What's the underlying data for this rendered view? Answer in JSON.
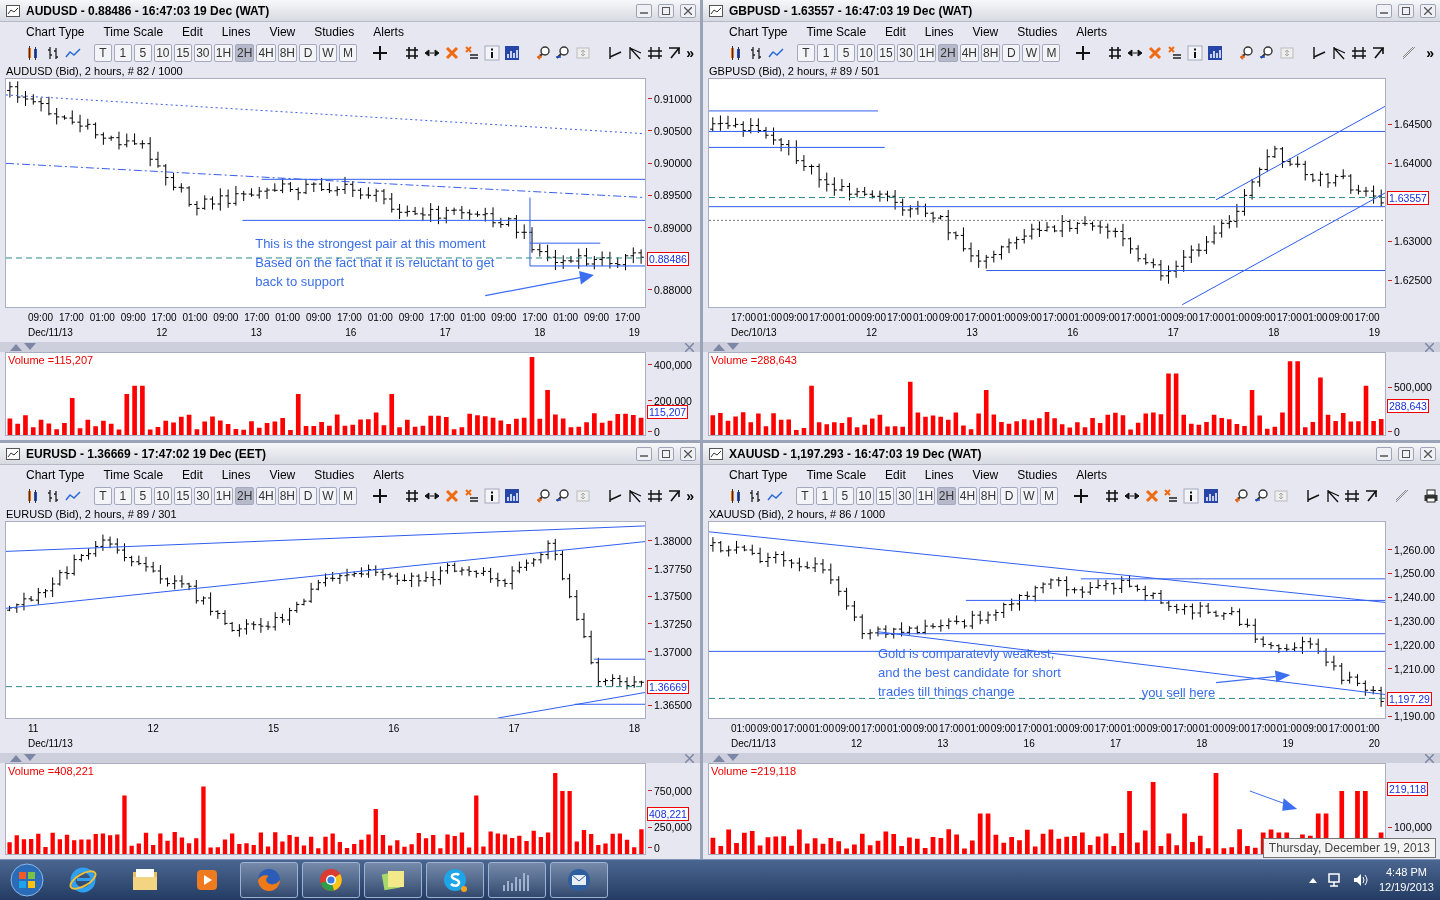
{
  "panes": [
    {
      "title": "AUDUSD - 0.88486 - 16:47:03  19 Dec (WAT)",
      "menu": [
        "Chart Type",
        "Time Scale",
        "Edit",
        "Lines",
        "View",
        "Studies",
        "Alerts"
      ],
      "timeframes": [
        {
          "label": "T",
          "selected": false
        },
        {
          "label": "1",
          "selected": false
        },
        {
          "label": "5",
          "selected": false
        },
        {
          "label": "10",
          "selected": false
        },
        {
          "label": "15",
          "selected": false
        },
        {
          "label": "30",
          "selected": false
        },
        {
          "label": "1H",
          "selected": false
        },
        {
          "label": "2H",
          "selected": true
        },
        {
          "label": "4H",
          "selected": false
        },
        {
          "label": "8H",
          "selected": false
        },
        {
          "label": "D",
          "selected": false
        },
        {
          "label": "W",
          "selected": false
        },
        {
          "label": "M",
          "selected": false
        }
      ],
      "overflow": "»",
      "info": "AUDUSD (Bid), 2 hours, # 82 / 1000",
      "price_axis": [
        "0.91000",
        "0.90500",
        "0.90000",
        "0.89500",
        "0.89000",
        "0.88000"
      ],
      "last_price": "0.88486",
      "times": [
        "09:00",
        "17:00",
        "01:00",
        "09:00",
        "17:00",
        "01:00",
        "09:00",
        "17:00",
        "01:00",
        "09:00",
        "17:00",
        "01:00",
        "09:00",
        "17:00",
        "01:00",
        "09:00",
        "17:00",
        "01:00",
        "09:00",
        "17:00"
      ],
      "dates": [
        "Dec/11/13",
        "12",
        "13",
        "16",
        "17",
        "18",
        "19"
      ],
      "annotations": [
        {
          "lines": [
            "This is the strongest pair at this moment",
            "Based on the fact that it is reluctant to get",
            "back to support"
          ]
        }
      ],
      "volume": {
        "label": "Volume =115,207",
        "axis": [
          "400,000",
          "200,000",
          "0"
        ],
        "last": "115,207"
      }
    },
    {
      "title": "GBPUSD - 1.63557 - 16:47:03  19 Dec (WAT)",
      "menu": [
        "Chart Type",
        "Time Scale",
        "Edit",
        "Lines",
        "View",
        "Studies",
        "Alerts"
      ],
      "timeframes": [
        {
          "label": "T",
          "selected": false
        },
        {
          "label": "1",
          "selected": false
        },
        {
          "label": "5",
          "selected": false
        },
        {
          "label": "10",
          "selected": false
        },
        {
          "label": "15",
          "selected": false
        },
        {
          "label": "30",
          "selected": false
        },
        {
          "label": "1H",
          "selected": false
        },
        {
          "label": "2H",
          "selected": true
        },
        {
          "label": "4H",
          "selected": false
        },
        {
          "label": "8H",
          "selected": false
        },
        {
          "label": "D",
          "selected": false
        },
        {
          "label": "W",
          "selected": false
        },
        {
          "label": "M",
          "selected": false
        }
      ],
      "extra_tools": [
        {
          "kind": "line"
        }
      ],
      "overflow": "»",
      "info": "GBPUSD (Bid), 2 hours, # 89 / 501",
      "price_axis": [
        "1.64500",
        "1.64000",
        "1.63000",
        "1.62500"
      ],
      "last_price": "1.63557",
      "times": [
        "17:00",
        "01:00",
        "09:00",
        "17:00",
        "01:00",
        "09:00",
        "17:00",
        "01:00",
        "09:00",
        "17:00",
        "01:00",
        "09:00",
        "17:00",
        "01:00",
        "09:00",
        "17:00",
        "01:00",
        "09:00",
        "17:00",
        "01:00",
        "09:00",
        "17:00",
        "01:00",
        "09:00",
        "17:00"
      ],
      "dates": [
        "Dec/10/13",
        "12",
        "13",
        "16",
        "17",
        "18",
        "19"
      ],
      "volume": {
        "label": "Volume =288,643",
        "axis": [
          "500,000",
          "0"
        ],
        "last": "288,643"
      }
    },
    {
      "title": "EURUSD - 1.36669 - 17:47:02  19 Dec (EET)",
      "menu": [
        "Chart Type",
        "Time Scale",
        "Edit",
        "Lines",
        "View",
        "Studies",
        "Alerts"
      ],
      "timeframes": [
        {
          "label": "T",
          "selected": false
        },
        {
          "label": "1",
          "selected": false
        },
        {
          "label": "5",
          "selected": false
        },
        {
          "label": "10",
          "selected": false
        },
        {
          "label": "15",
          "selected": false
        },
        {
          "label": "30",
          "selected": false
        },
        {
          "label": "1H",
          "selected": false
        },
        {
          "label": "2H",
          "selected": true
        },
        {
          "label": "4H",
          "selected": false
        },
        {
          "label": "8H",
          "selected": false
        },
        {
          "label": "D",
          "selected": false
        },
        {
          "label": "W",
          "selected": false
        },
        {
          "label": "M",
          "selected": false
        }
      ],
      "overflow": "»",
      "info": "EURUSD (Bid), 2 hours, # 89 / 301",
      "price_axis": [
        "1.38000",
        "1.37750",
        "1.37500",
        "1.37250",
        "1.37000",
        "1.36500"
      ],
      "last_price": "1.36669",
      "times": [
        "11",
        "12",
        "15",
        "16",
        "17",
        "18"
      ],
      "dates": [
        "Dec/11/13"
      ],
      "volume": {
        "label": "Volume =408,221",
        "axis": [
          "750,000",
          "250,000",
          "0"
        ],
        "last": "408,221"
      }
    },
    {
      "title": "XAUUSD - 1,197.293 - 16:47:03  19 Dec (WAT)",
      "menu": [
        "Chart Type",
        "Time Scale",
        "Edit",
        "Lines",
        "View",
        "Studies",
        "Alerts"
      ],
      "timeframes": [
        {
          "label": "T",
          "selected": false
        },
        {
          "label": "1",
          "selected": false
        },
        {
          "label": "5",
          "selected": false
        },
        {
          "label": "10",
          "selected": false
        },
        {
          "label": "15",
          "selected": false
        },
        {
          "label": "30",
          "selected": false
        },
        {
          "label": "1H",
          "selected": false
        },
        {
          "label": "2H",
          "selected": true
        },
        {
          "label": "4H",
          "selected": false
        },
        {
          "label": "8H",
          "selected": false
        },
        {
          "label": "D",
          "selected": false
        },
        {
          "label": "W",
          "selected": false
        },
        {
          "label": "M",
          "selected": false
        }
      ],
      "extra_tools": [
        {
          "kind": "line"
        },
        {
          "kind": "print"
        }
      ],
      "info": "XAUUSD (Bid), 2 hours, # 86 / 1000",
      "price_axis": [
        "1,260.00",
        "1,250.00",
        "1,240.00",
        "1,230.00",
        "1,220.00",
        "1,210.00",
        "1,190.00"
      ],
      "last_price": "1,197.29",
      "times": [
        "01:00",
        "09:00",
        "17:00",
        "01:00",
        "09:00",
        "17:00",
        "01:00",
        "09:00",
        "17:00",
        "01:00",
        "09:00",
        "17:00",
        "01:00",
        "09:00",
        "17:00",
        "01:00",
        "09:00",
        "17:00",
        "01:00",
        "09:00",
        "17:00",
        "01:00",
        "09:00",
        "17:00",
        "01:00"
      ],
      "dates": [
        "Dec/11/13",
        "12",
        "13",
        "16",
        "17",
        "18",
        "19",
        "20"
      ],
      "annotations": [
        {
          "lines": [
            "Gold is comparatevly weakest,",
            "and the best candidate for short",
            "trades till things change"
          ]
        },
        {
          "lines": [
            "you sell here"
          ]
        }
      ],
      "volume": {
        "label": "Volume =219,118",
        "axis": [
          "100,000"
        ],
        "last": "219,118"
      }
    }
  ],
  "taskbar": {
    "apps": [
      {
        "kind": "browser-e",
        "open": false
      },
      {
        "kind": "folder",
        "open": false
      },
      {
        "kind": "media",
        "open": false
      },
      {
        "kind": "fox",
        "open": true
      },
      {
        "kind": "chrome",
        "open": true
      },
      {
        "kind": "notes",
        "open": true
      },
      {
        "kind": "chat",
        "open": true
      },
      {
        "kind": "chart",
        "open": true
      },
      {
        "kind": "mail",
        "open": true
      }
    ],
    "time": "4:48 PM",
    "date": "12/19/2013"
  },
  "tooltip": "Thursday, December 19, 2013"
}
